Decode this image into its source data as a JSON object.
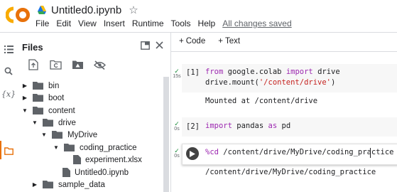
{
  "header": {
    "doc_title": "Untitled0.ipynb",
    "menu": [
      "File",
      "Edit",
      "View",
      "Insert",
      "Runtime",
      "Tools",
      "Help"
    ],
    "save_status": "All changes saved",
    "logo_text": "CO"
  },
  "sidebar": {
    "files_title": "Files",
    "tree": [
      {
        "label": "bin",
        "type": "folder",
        "expanded": false,
        "depth": 0
      },
      {
        "label": "boot",
        "type": "folder",
        "expanded": false,
        "depth": 0
      },
      {
        "label": "content",
        "type": "folder",
        "expanded": true,
        "depth": 0
      },
      {
        "label": "drive",
        "type": "folder",
        "expanded": true,
        "depth": 1
      },
      {
        "label": "MyDrive",
        "type": "folder",
        "expanded": true,
        "depth": 2
      },
      {
        "label": "coding_practice",
        "type": "folder",
        "expanded": true,
        "depth": 3
      },
      {
        "label": "experiment.xlsx",
        "type": "file",
        "depth": 4
      },
      {
        "label": "Untitled0.ipynb",
        "type": "file",
        "depth": 3
      },
      {
        "label": "sample_data",
        "type": "folder",
        "expanded": false,
        "depth": 1
      }
    ]
  },
  "toolbar": {
    "code_label": "Code",
    "text_label": "Text"
  },
  "cells": [
    {
      "exec_label": "[1]",
      "time": "15s",
      "code_line1": {
        "kw1": "from",
        "mod": " google.colab ",
        "kw2": "import",
        "name": " drive"
      },
      "code_line2": {
        "prefix": "drive.mount(",
        "str": "'/content/drive'",
        "suffix": ")"
      },
      "output": "Mounted at /content/drive"
    },
    {
      "exec_label": "[2]",
      "time": "0s",
      "code": {
        "kw1": "import",
        "mod": " pandas ",
        "kw2": "as",
        "alias": " pd"
      }
    },
    {
      "exec_label": "",
      "time": "0s",
      "code": {
        "magic": "%cd",
        "path": " /content/drive/MyDrive/coding_practice"
      },
      "output": "/content/drive/MyDrive/coding_practice"
    }
  ],
  "colors": {
    "accent": "#e8710a",
    "logo_yellow": "#f9ab00",
    "keyword": "#9c27b0",
    "string": "#c5221f",
    "success": "#1e8e3e"
  }
}
